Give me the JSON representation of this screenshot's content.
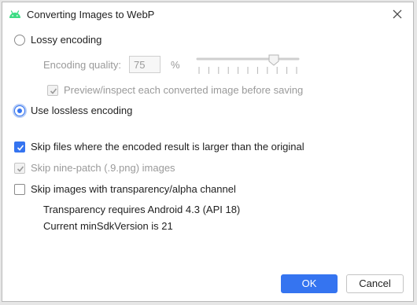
{
  "dialog": {
    "title": "Converting Images to WebP",
    "icon": "android-icon",
    "accent_color": "#3574f0",
    "icon_color": "#3ddc84"
  },
  "encoding": {
    "lossy_label": "Lossy encoding",
    "lossy_selected": false,
    "quality_label": "Encoding quality:",
    "quality_value": "75",
    "quality_unit": "%",
    "slider_value": 75,
    "preview_label": "Preview/inspect each converted image before saving",
    "preview_checked": true,
    "lossless_label": "Use lossless encoding",
    "lossless_selected": true
  },
  "options": {
    "skip_larger_label": "Skip files where the encoded result is larger than the original",
    "skip_larger_checked": true,
    "skip_ninepatch_label": "Skip nine-patch (.9.png) images",
    "skip_ninepatch_checked": true,
    "skip_transparency_label": "Skip images with transparency/alpha channel",
    "skip_transparency_checked": false,
    "transparency_note": "Transparency requires Android 4.3 (API 18)",
    "min_sdk_note": "Current minSdkVersion is 21"
  },
  "buttons": {
    "ok_label": "OK",
    "cancel_label": "Cancel"
  }
}
